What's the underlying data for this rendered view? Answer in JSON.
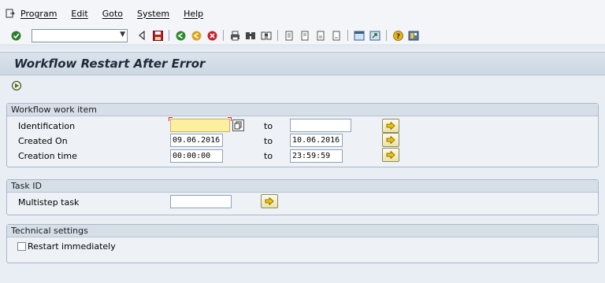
{
  "menu": {
    "items": [
      "Program",
      "Edit",
      "Goto",
      "System",
      "Help"
    ]
  },
  "toolbar": {
    "command_value": "",
    "icons": [
      "enter-icon",
      "back-icon",
      "save-icon",
      "back-green-icon",
      "exit-yellow-icon",
      "cancel-icon",
      "print-icon",
      "find-icon",
      "find-next-icon",
      "first-page-icon",
      "previous-page-icon",
      "next-page-icon",
      "last-page-icon",
      "create-session-icon",
      "shortcut-icon",
      "help-icon",
      "customize-layout-icon"
    ]
  },
  "title": "Workflow Restart After Error",
  "groups": {
    "work_item": {
      "header": "Workflow work item",
      "identification_label": "Identification",
      "identification_value": "",
      "identification_to_label": "to",
      "identification_to_value": "",
      "created_on_label": "Created On",
      "created_on_from": "09.06.2016",
      "created_on_to_label": "to",
      "created_on_to": "10.06.2016",
      "creation_time_label": "Creation time",
      "creation_time_from": "00:00:00",
      "creation_time_to_label": "to",
      "creation_time_to": "23:59:59"
    },
    "task": {
      "header": "Task ID",
      "multistep_label": "Multistep task",
      "multistep_value": ""
    },
    "technical": {
      "header": "Technical settings",
      "restart_label": "Restart immediately",
      "restart_checked": false
    }
  },
  "colors": {
    "background": "#e9eef4",
    "required_field": "#fcefa0",
    "title_text": "#1d2a3a"
  }
}
